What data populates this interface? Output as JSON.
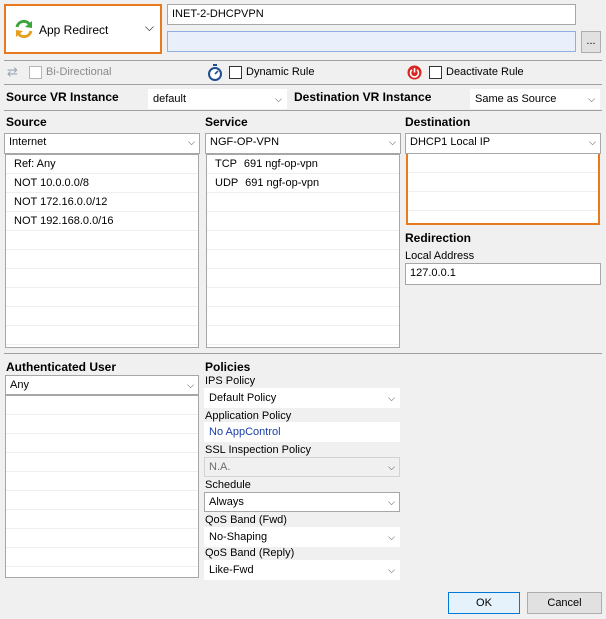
{
  "rule_type": {
    "label": "App Redirect",
    "icon": "refresh-arrows-icon"
  },
  "rule_name": "INET-2-DHCPVPN",
  "rule_description": "",
  "browse_label": "...",
  "options": {
    "bidirectional": "Bi-Directional",
    "dynamic_rule": "Dynamic Rule",
    "deactivate_rule": "Deactivate Rule"
  },
  "vr": {
    "source_label": "Source VR Instance",
    "source_value": "default",
    "dest_label": "Destination VR Instance",
    "dest_value": "Same as Source"
  },
  "source": {
    "label": "Source",
    "selected": "Internet",
    "items": [
      "Ref: Any",
      "NOT 10.0.0.0/8",
      "NOT 172.16.0.0/12",
      "NOT 192.168.0.0/16"
    ]
  },
  "service": {
    "label": "Service",
    "selected": "NGF-OP-VPN",
    "items": [
      {
        "proto": "TCP",
        "detail": "691 ngf-op-vpn"
      },
      {
        "proto": "UDP",
        "detail": "691 ngf-op-vpn"
      }
    ]
  },
  "destination": {
    "label": "Destination",
    "selected": "DHCP1 Local IP"
  },
  "redirection": {
    "label": "Redirection",
    "local_address_label": "Local Address",
    "local_address_value": "127.0.0.1"
  },
  "auth_user": {
    "label": "Authenticated User",
    "selected": "Any"
  },
  "policies": {
    "label": "Policies",
    "ips_label": "IPS Policy",
    "ips_value": "Default Policy",
    "app_label": "Application Policy",
    "app_value": "No AppControl",
    "ssl_label": "SSL Inspection Policy",
    "ssl_value": "N.A.",
    "schedule_label": "Schedule",
    "schedule_value": "Always",
    "qos_fwd_label": "QoS Band (Fwd)",
    "qos_fwd_value": "No-Shaping",
    "qos_reply_label": "QoS Band (Reply)",
    "qos_reply_value": "Like-Fwd"
  },
  "buttons": {
    "ok": "OK",
    "cancel": "Cancel"
  }
}
